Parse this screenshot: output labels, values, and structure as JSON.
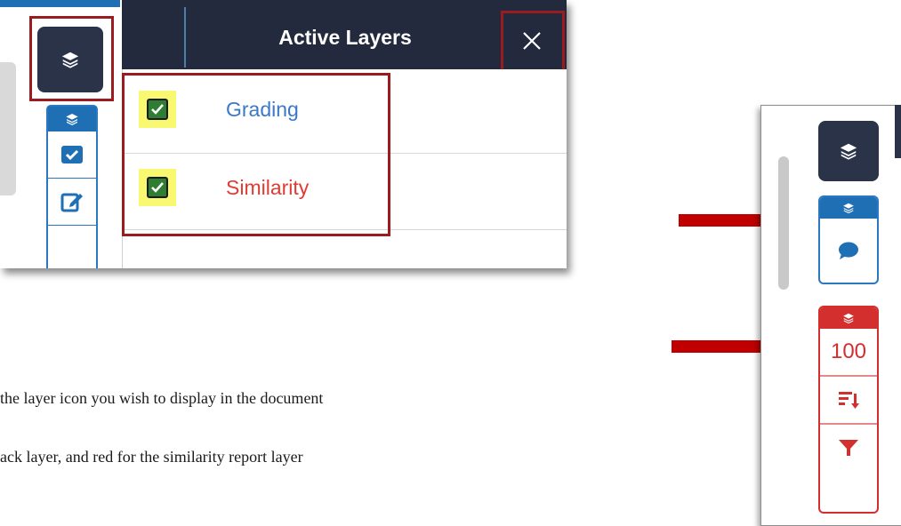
{
  "active_layers_panel": {
    "title": "Active Layers",
    "close_icon": "close-icon",
    "layers": [
      {
        "label": "Grading",
        "checked": true,
        "color": "#3a78c9"
      },
      {
        "label": "Similarity",
        "checked": true,
        "color": "#e03c31"
      }
    ]
  },
  "left_toolbar": {
    "layers_button_icon": "layers-icon",
    "items": [
      "layers-icon",
      "checkbox-icon",
      "edit-icon"
    ]
  },
  "instructions": {
    "line1": "the layer icon you wish to display in the document",
    "line2": "ack layer, and red for the similarity report layer"
  },
  "right_toolbar": {
    "layers_button_icon": "layers-icon",
    "feedback_group": {
      "color": "#2b78c2",
      "icon": "comment-icon"
    },
    "similarity_group": {
      "color": "#d32f2f",
      "score": "100",
      "icons": [
        "sort-icon",
        "filter-icon"
      ]
    }
  },
  "colors": {
    "accent_red_outline": "#9b1c1f",
    "arrow_red": "#c00000",
    "dark_navy": "#232a3d"
  }
}
